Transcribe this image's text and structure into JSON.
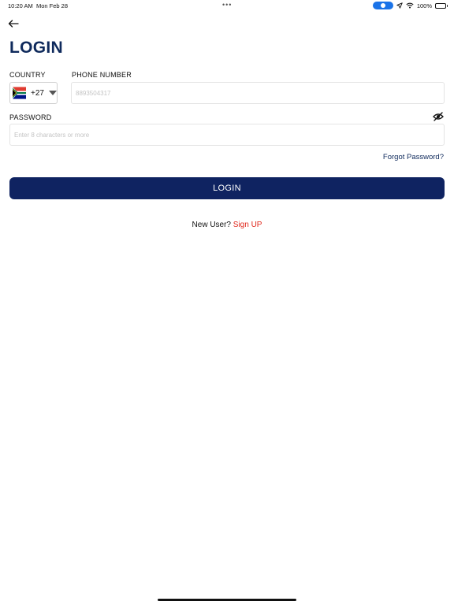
{
  "status_bar": {
    "time": "10:20 AM",
    "date": "Mon Feb 28",
    "dots": "•••",
    "battery_text": "100%",
    "battery_level": 1.0,
    "pill_color": "#1a73e8"
  },
  "page": {
    "title": "LOGIN"
  },
  "country": {
    "label": "COUNTRY",
    "code": "+27",
    "flag_icon": "south-africa-flag-icon"
  },
  "phone": {
    "label": "PHONE NUMBER",
    "placeholder": "8893504317",
    "value": ""
  },
  "password": {
    "label": "PASSWORD",
    "placeholder": "Enter 8 characters or more",
    "value": "",
    "toggle_icon": "eye-slash-icon"
  },
  "links": {
    "forgot": "Forgot Password?",
    "new_user": "New User?",
    "sign_up": "Sign UP"
  },
  "buttons": {
    "login": "LOGIN"
  },
  "colors": {
    "primary": "#0f2361",
    "title": "#0f2a5c",
    "accent_red": "#e0271b"
  }
}
